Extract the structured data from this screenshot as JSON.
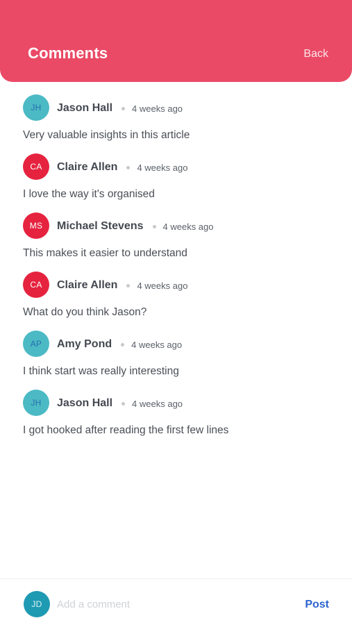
{
  "header": {
    "title": "Comments",
    "back_label": "Back",
    "color": "#ea4a66"
  },
  "comments": [
    {
      "initials": "JH",
      "name": "Jason Hall",
      "time": "4 weeks ago",
      "text": "Very valuable insights in this article",
      "avatar_bg": "#4bbac4",
      "avatar_fg": "#2a6fb0"
    },
    {
      "initials": "CA",
      "name": "Claire Allen",
      "time": "4 weeks ago",
      "text": "I love the way it's organised",
      "avatar_bg": "#e5233f",
      "avatar_fg": "#ffffff"
    },
    {
      "initials": "MS",
      "name": "Michael Stevens",
      "time": "4 weeks ago",
      "text": "This makes it easier to understand",
      "avatar_bg": "#e5233f",
      "avatar_fg": "#ffffff"
    },
    {
      "initials": "CA",
      "name": "Claire Allen",
      "time": "4 weeks ago",
      "text": "What do you think Jason?",
      "avatar_bg": "#e5233f",
      "avatar_fg": "#ffffff"
    },
    {
      "initials": "AP",
      "name": "Amy Pond",
      "time": "4 weeks ago",
      "text": "I think start was really interesting",
      "avatar_bg": "#4bbac4",
      "avatar_fg": "#2a6fb0"
    },
    {
      "initials": "JH",
      "name": "Jason Hall",
      "time": "4 weeks ago",
      "text": "I got hooked after reading the first few lines",
      "avatar_bg": "#4bbac4",
      "avatar_fg": "#2a6fb0"
    }
  ],
  "footer": {
    "user_initials": "JD",
    "user_avatar_bg": "#1f9ab3",
    "user_avatar_fg": "#dff3f7",
    "input_placeholder": "Add a comment",
    "input_value": "",
    "post_label": "Post",
    "post_color": "#2e64d0"
  }
}
